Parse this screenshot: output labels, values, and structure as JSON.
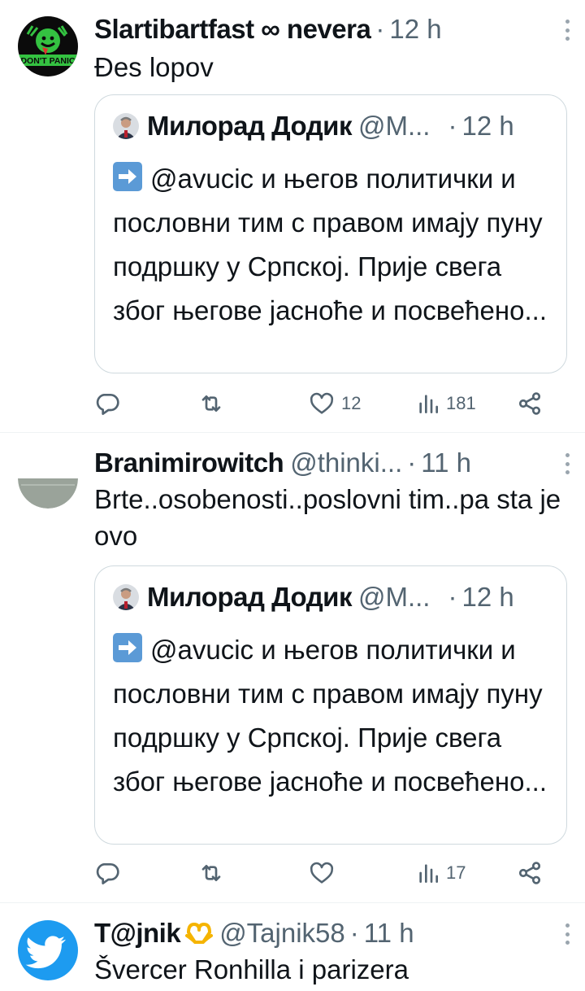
{
  "tweets": [
    {
      "name": "Slartibartfast ∞ nevera",
      "handle": "",
      "sep": "·",
      "time": "12 h",
      "text": "Đes lopov",
      "avatar_icon": "dont-panic-avatar",
      "avatar_text": "DON'T PANIC",
      "quote": {
        "name": "Милорад Додик",
        "handle": "@М...",
        "sep": "·",
        "time": "12 h",
        "text": "@avucic и његов политички и пословни тим с правом имају пуну подршку у Српској. Прије свега због његове јасноће и посвећено..."
      },
      "actions": {
        "reply": "",
        "retweet": "",
        "likes": "12",
        "views": "181"
      }
    },
    {
      "name": "Branimirowitch",
      "handle": "@thinki...",
      "sep": "·",
      "time": "11 h",
      "text": "Brte..osobenosti..poslovni tim..pa sta je ovo",
      "avatar_icon": "gray-avatar",
      "quote": {
        "name": "Милорад Додик",
        "handle": "@М...",
        "sep": "·",
        "time": "12 h",
        "text": "@avucic и његов политички и пословни тим с правом имају пуну подршку у Српској. Прије свега због његове јасноће и посвећено..."
      },
      "actions": {
        "reply": "",
        "retweet": "",
        "likes": "",
        "views": "17"
      }
    },
    {
      "name": "T@jnik",
      "name_emoji": "heart-hands-emoji",
      "handle": "@Tajnik58",
      "sep": "·",
      "time": "11 h",
      "text": "Švercer Ronhilla i parizera",
      "avatar_icon": "twitter-bird-avatar"
    }
  ],
  "colors": {
    "text": "#0f1419",
    "secondary": "#536471",
    "border": "#cfd9de",
    "twitter_blue": "#1d9bf0"
  }
}
